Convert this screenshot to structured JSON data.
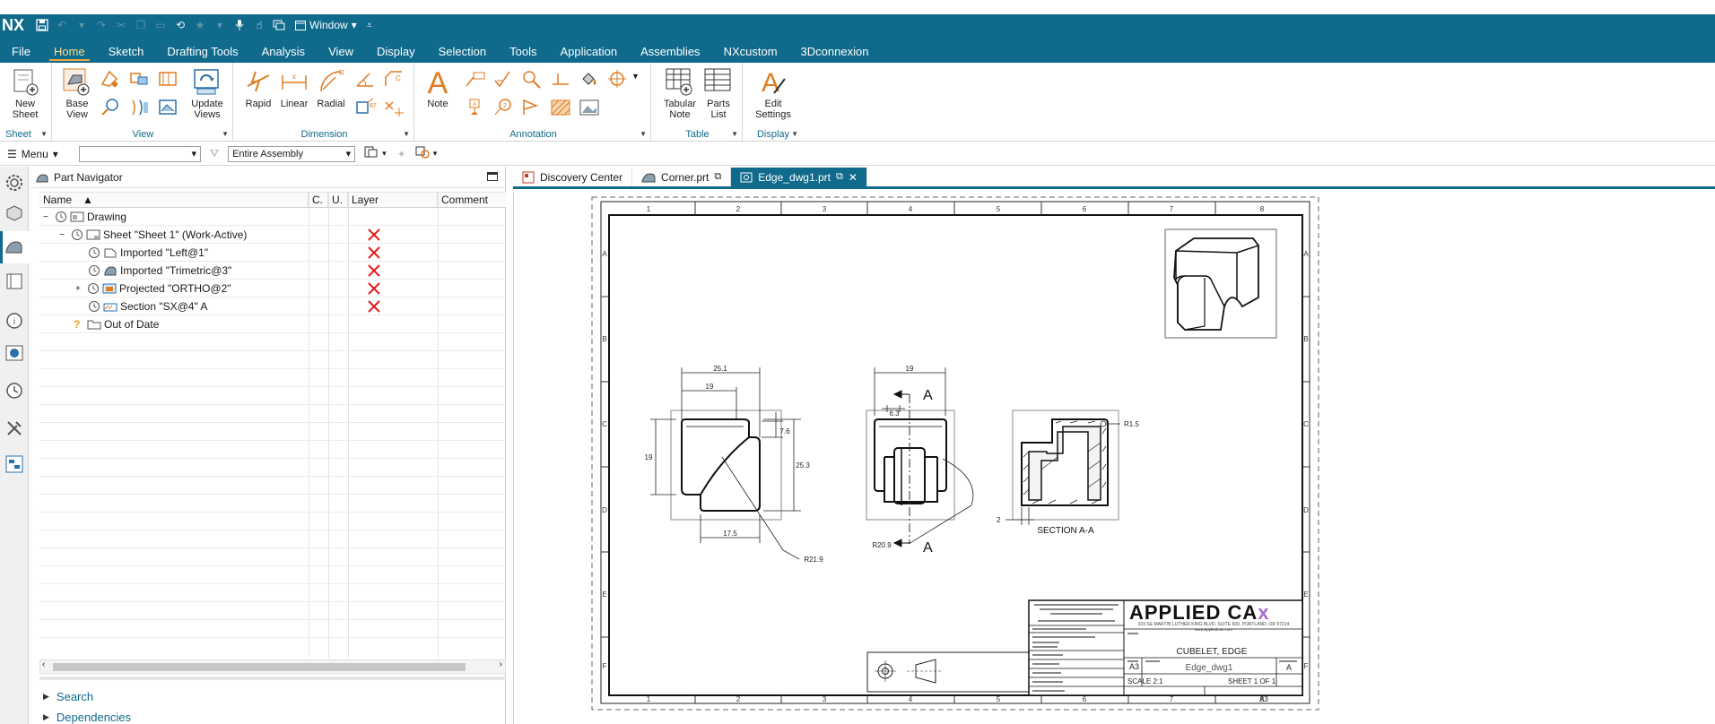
{
  "app": {
    "logo": "NX",
    "window_label": "Window"
  },
  "menu_tabs": [
    "File",
    "Home",
    "Sketch",
    "Drafting Tools",
    "Analysis",
    "View",
    "Display",
    "Selection",
    "Tools",
    "Application",
    "Assemblies",
    "NXcustom",
    "3Dconnexion"
  ],
  "ribbon": {
    "new_sheet": "New Sheet",
    "base_view": "Base View",
    "update_views": "Update Views",
    "rapid": "Rapid",
    "linear": "Linear",
    "radial": "Radial",
    "note": "Note",
    "tabular_note": "Tabular Note",
    "parts_list": "Parts List",
    "edit_settings": "Edit Settings",
    "groups": {
      "sheet": "Sheet",
      "view": "View",
      "dimension": "Dimension",
      "annotation": "Annotation",
      "table": "Table",
      "display": "Display"
    }
  },
  "toolbar": {
    "menu": "Menu",
    "filter_value": "",
    "scope": "Entire Assembly"
  },
  "navigator": {
    "title": "Part Navigator",
    "columns": [
      "Name",
      "C.",
      "U.",
      "Layer",
      "Comment"
    ],
    "items": [
      {
        "label": "Drawing"
      },
      {
        "label": "Sheet \"Sheet 1\" (Work-Active)"
      },
      {
        "label": "Imported \"Left@1\""
      },
      {
        "label": "Imported \"Trimetric@3\""
      },
      {
        "label": "Projected \"ORTHO@2\""
      },
      {
        "label": "Section \"SX@4\" A"
      },
      {
        "label": "Out of Date"
      }
    ],
    "search": "Search",
    "dependencies": "Dependencies"
  },
  "doc_tabs": [
    "Discovery Center",
    "Corner.prt",
    "Edge_dwg1.prt"
  ],
  "drawing": {
    "col_labels": [
      "1",
      "2",
      "3",
      "4",
      "5",
      "6",
      "7",
      "8"
    ],
    "row_labels": [
      "A",
      "B",
      "C",
      "D",
      "E",
      "F"
    ],
    "dims": {
      "d1": "25.1",
      "d2": "19",
      "d3": "19",
      "d4": "7.6",
      "d5": "25.3",
      "d6": "17.5",
      "r1": "R21.9",
      "top19": "19",
      "d63": "6.3",
      "secA_top": "A",
      "secA_bot": "A",
      "r209": "R20.9",
      "r15": "R1.5",
      "two": "2",
      "section_label": "SECTION A-A"
    },
    "title_block": {
      "company": "APPLIED CA",
      "company_x": "x",
      "address": "333 SE MARTIN LUTHER KING BLVD, SUITE 500, PORTLAND, OR 97214",
      "web": "www.appliedcax.com",
      "title_value": "CUBELET, EDGE",
      "size": "A3",
      "dwg_no": "Edge_dwg1",
      "rev": "A",
      "scale": "SCALE 2:1",
      "sheet": "SHEET 1 OF 1",
      "bottom_code": "A3"
    }
  }
}
